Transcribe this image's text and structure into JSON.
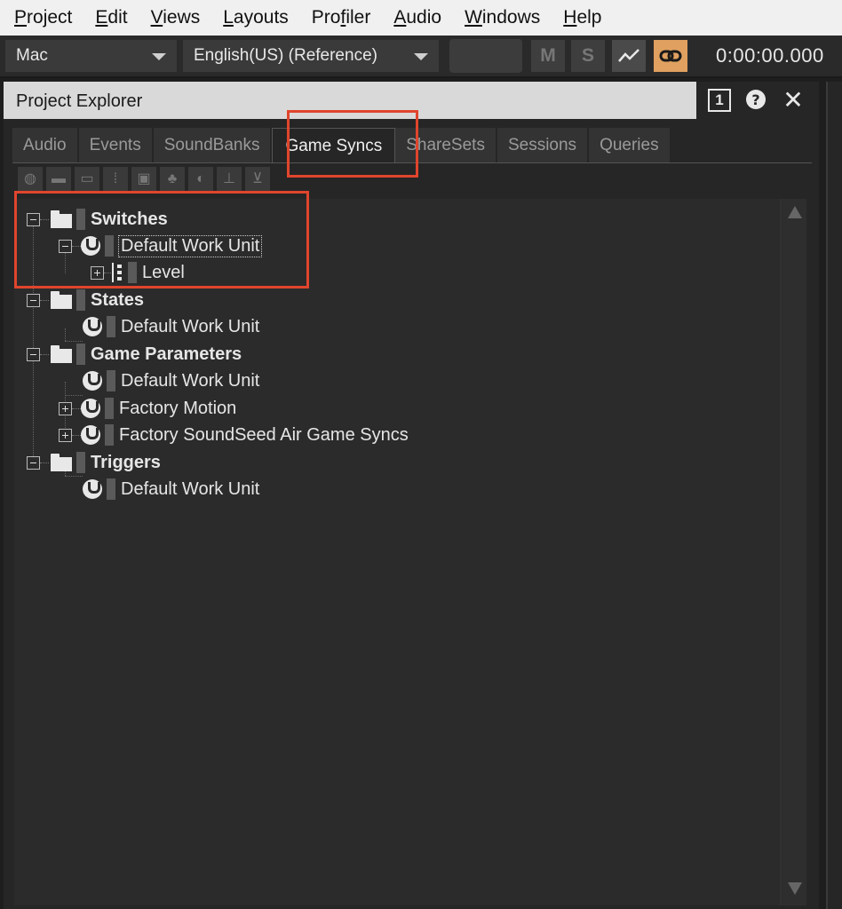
{
  "menubar": {
    "items": [
      {
        "pre": "",
        "ul": "P",
        "post": "roject"
      },
      {
        "pre": "",
        "ul": "E",
        "post": "dit"
      },
      {
        "pre": "",
        "ul": "V",
        "post": "iews"
      },
      {
        "pre": "",
        "ul": "L",
        "post": "ayouts"
      },
      {
        "pre": "Pro",
        "ul": "f",
        "post": "iler"
      },
      {
        "pre": "",
        "ul": "A",
        "post": "udio"
      },
      {
        "pre": "",
        "ul": "W",
        "post": "indows"
      },
      {
        "pre": "",
        "ul": "H",
        "post": "elp"
      }
    ]
  },
  "toolbar": {
    "platform": "Mac",
    "language": "English(US) (Reference)",
    "mute_label": "M",
    "solo_label": "S",
    "time": "0:00:00.000",
    "link_color": "#e0a060"
  },
  "panel": {
    "title": "Project Explorer",
    "number_badge": "1",
    "help_glyph": "?",
    "close_glyph": "✕",
    "tabs": [
      "Audio",
      "Events",
      "SoundBanks",
      "Game Syncs",
      "ShareSets",
      "Sessions",
      "Queries"
    ],
    "active_tab": "Game Syncs"
  },
  "tree": {
    "switches": {
      "label": "Switches",
      "work_unit": "Default Work Unit",
      "child": "Level"
    },
    "states": {
      "label": "States",
      "work_unit": "Default Work Unit"
    },
    "game_parameters": {
      "label": "Game Parameters",
      "work_unit": "Default Work Unit",
      "factory_motion": "Factory Motion",
      "factory_soundseed": "Factory SoundSeed Air Game Syncs"
    },
    "triggers": {
      "label": "Triggers",
      "work_unit": "Default Work Unit"
    }
  },
  "highlight_color": "#e0452d"
}
